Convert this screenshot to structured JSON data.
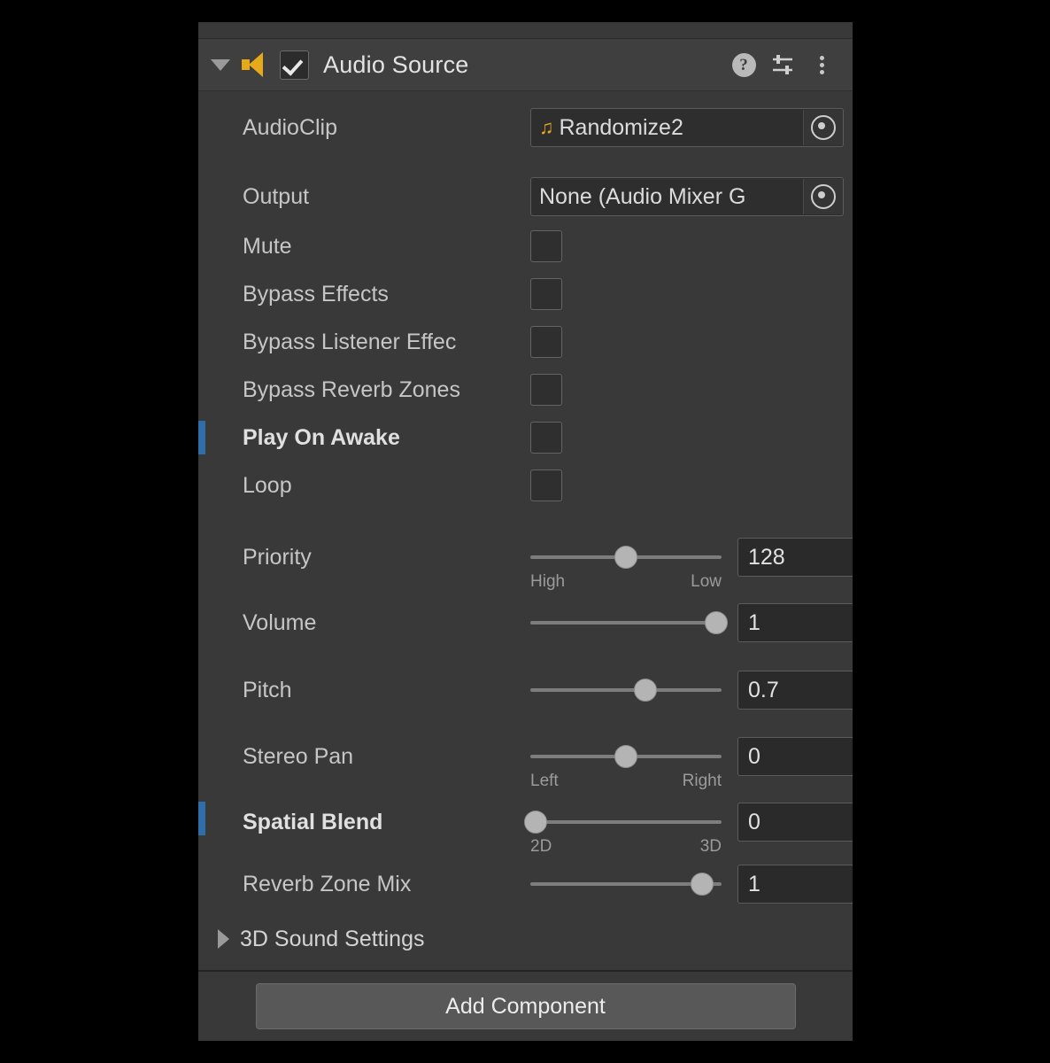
{
  "component": {
    "title": "Audio Source",
    "enabled": true,
    "expanded": true,
    "icon": "speaker-icon",
    "header_icons": [
      "help-icon",
      "preset-icon",
      "more-menu-icon"
    ],
    "accent_color": "#e6a919",
    "override_color": "#2f6ea8"
  },
  "object_fields": [
    {
      "label": "AudioClip",
      "value": "Randomize2",
      "icon": "audio-clip-icon",
      "has_icon": true,
      "picker": "object-picker-icon"
    },
    {
      "label": "Output",
      "value": "None (Audio Mixer G",
      "has_icon": false,
      "picker": "object-picker-icon"
    }
  ],
  "toggles": [
    {
      "label": "Mute",
      "checked": false,
      "overridden": false
    },
    {
      "label": "Bypass Effects",
      "checked": false,
      "overridden": false
    },
    {
      "label": "Bypass Listener Effec",
      "checked": false,
      "overridden": false
    },
    {
      "label": "Bypass Reverb Zones",
      "checked": false,
      "overridden": false
    },
    {
      "label": "Play On Awake",
      "checked": false,
      "overridden": true
    },
    {
      "label": "Loop",
      "checked": false,
      "overridden": false
    }
  ],
  "sliders": [
    {
      "label": "Priority",
      "value": "128",
      "pct": 50,
      "min_label": "High",
      "max_label": "Low",
      "overridden": false
    },
    {
      "label": "Volume",
      "value": "1",
      "pct": 97,
      "min_label": "",
      "max_label": "",
      "overridden": false
    },
    {
      "label": "Pitch",
      "value": "0.7",
      "pct": 60,
      "min_label": "",
      "max_label": "",
      "overridden": false
    },
    {
      "label": "Stereo Pan",
      "value": "0",
      "pct": 50,
      "min_label": "Left",
      "max_label": "Right",
      "overridden": false
    },
    {
      "label": "Spatial Blend",
      "value": "0",
      "pct": 3,
      "min_label": "2D",
      "max_label": "3D",
      "overridden": true
    },
    {
      "label": "Reverb Zone Mix",
      "value": "1",
      "pct": 90,
      "min_label": "",
      "max_label": "",
      "overridden": false
    }
  ],
  "foldout": {
    "label": "3D Sound Settings",
    "expanded": false
  },
  "footer": {
    "add_component_label": "Add Component"
  }
}
